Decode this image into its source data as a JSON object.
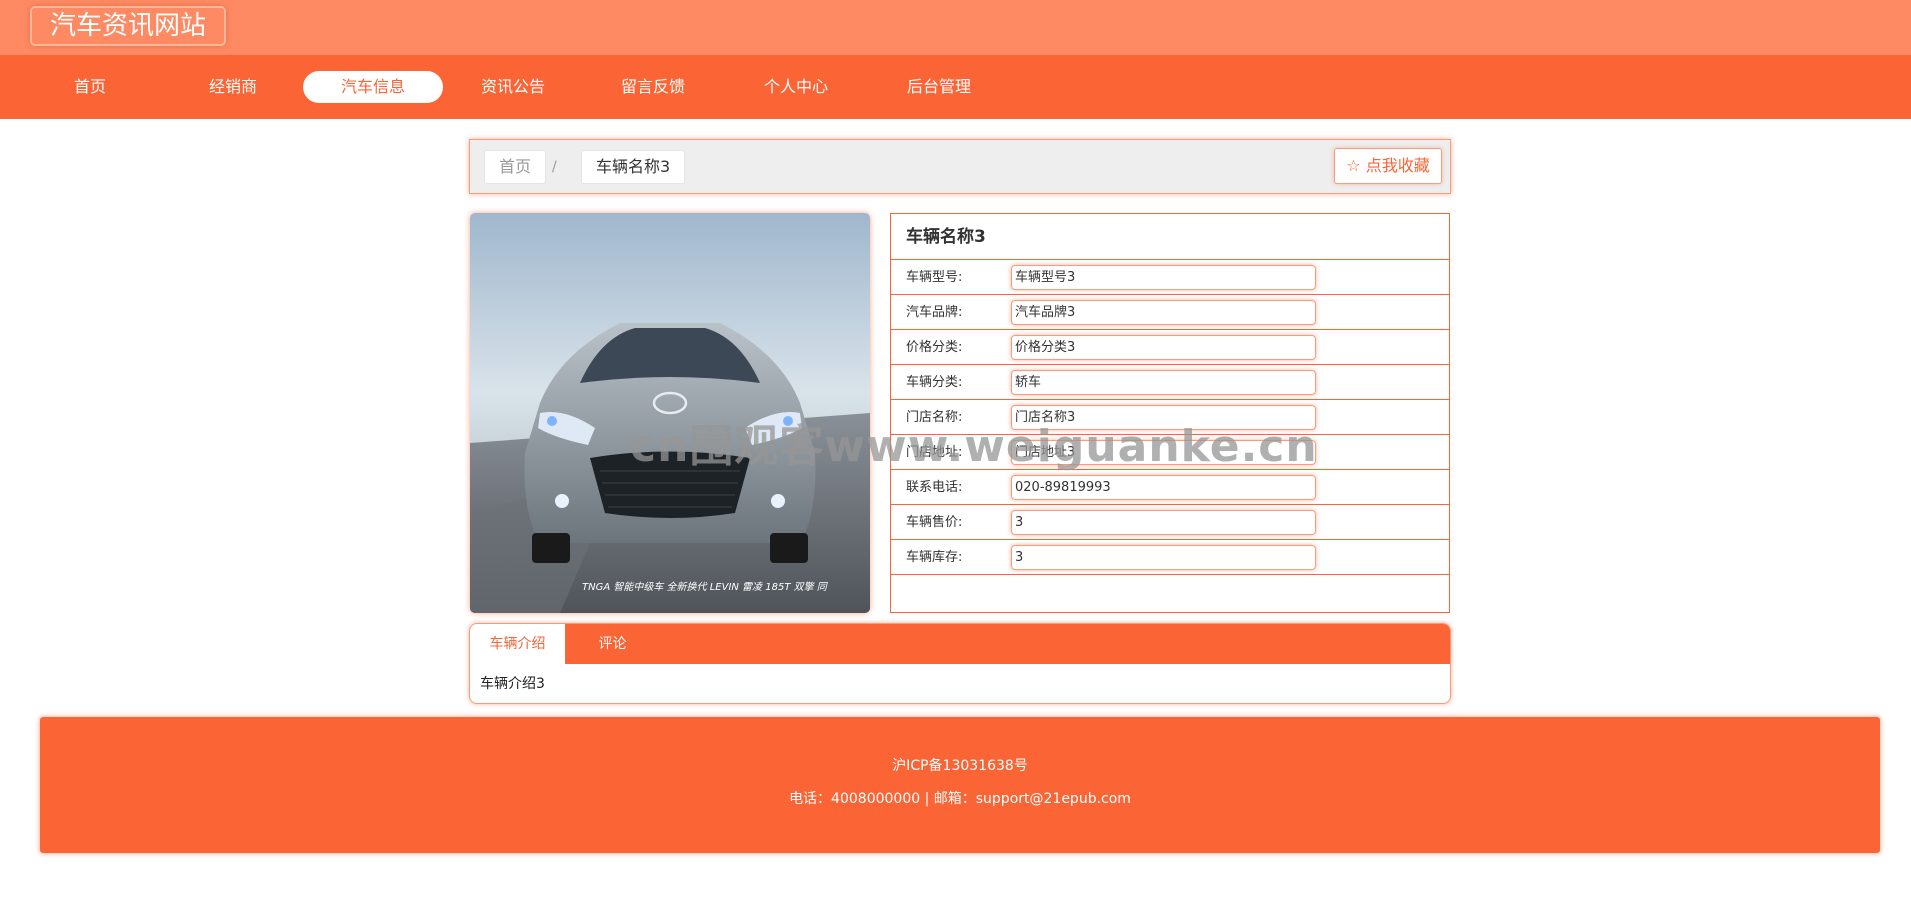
{
  "header": {
    "site_title": "汽车资讯网站"
  },
  "nav": {
    "items": [
      {
        "label": "首页"
      },
      {
        "label": "经销商"
      },
      {
        "label": "汽车信息"
      },
      {
        "label": "资讯公告"
      },
      {
        "label": "留言反馈"
      },
      {
        "label": "个人中心"
      },
      {
        "label": "后台管理"
      }
    ],
    "active_index": 2
  },
  "breadcrumb": {
    "home": "首页",
    "separator": "/",
    "current": "车辆名称3"
  },
  "favorite_button": {
    "label": "☆ 点我收藏"
  },
  "detail": {
    "title": "车辆名称3",
    "fields": [
      {
        "label": "车辆型号:",
        "value": "车辆型号3"
      },
      {
        "label": "汽车品牌:",
        "value": "汽车品牌3"
      },
      {
        "label": "价格分类:",
        "value": "价格分类3"
      },
      {
        "label": "车辆分类:",
        "value": "轿车"
      },
      {
        "label": "门店名称:",
        "value": "门店名称3"
      },
      {
        "label": "门店地址:",
        "value": "门店地址3"
      },
      {
        "label": "联系电话:",
        "value": "020-89819993"
      },
      {
        "label": "车辆售价:",
        "value": "3"
      },
      {
        "label": "车辆库存:",
        "value": "3"
      }
    ]
  },
  "image": {
    "brand_caption": "TNGA 智能中级车  全新换代  LEVIN 雷凌 185T 双擎 同"
  },
  "tabs": {
    "items": [
      {
        "label": "车辆介绍"
      },
      {
        "label": "评论"
      }
    ],
    "active_index": 0,
    "content": "车辆介绍3"
  },
  "footer": {
    "icp": "沪ICP备13031638号",
    "contact": "电话：4008000000 | 邮箱：support@21epub.com"
  },
  "watermark": {
    "text": "cn围观客www.weiguanke.cn"
  },
  "colors": {
    "accent": "#fb6434",
    "header": "#fd8a62",
    "crumb_bg": "#eeeeee"
  }
}
